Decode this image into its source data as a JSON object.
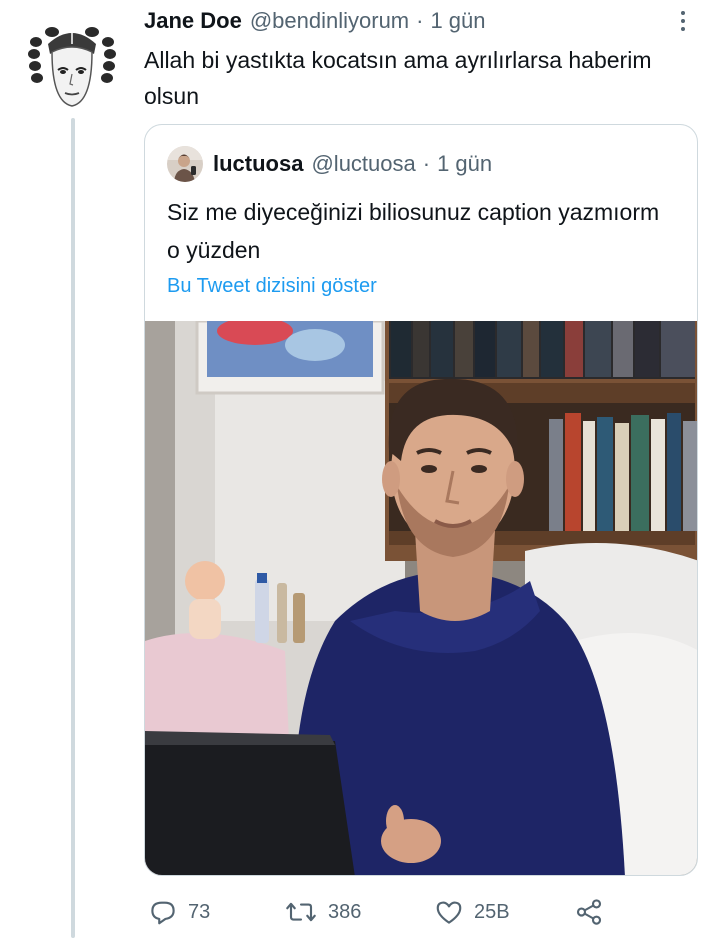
{
  "tweet": {
    "author_name": "Jane Doe",
    "handle": "@bendinliyorum",
    "separator": "·",
    "time": "1 gün",
    "text": "Allah bi yastıkta kocatsın ama ayrılırlarsa haberim olsun"
  },
  "quote": {
    "author_name": "luctuosa",
    "handle": "@luctuosa",
    "separator": "·",
    "time": "1 gün",
    "text": "Siz me diyeceğinizi biliosunuz caption yazmıorm o yüzden",
    "thread_link": "Bu Tweet dizisini göster"
  },
  "actions": {
    "replies": "73",
    "retweets": "386",
    "likes": "25B"
  },
  "icons": {
    "more": "more-dots-icon",
    "reply": "reply-icon",
    "retweet": "retweet-icon",
    "like": "heart-icon",
    "share": "share-icon"
  },
  "colors": {
    "link": "#1d9bf0",
    "secondary_text": "#536471",
    "border": "#cfd9de"
  }
}
